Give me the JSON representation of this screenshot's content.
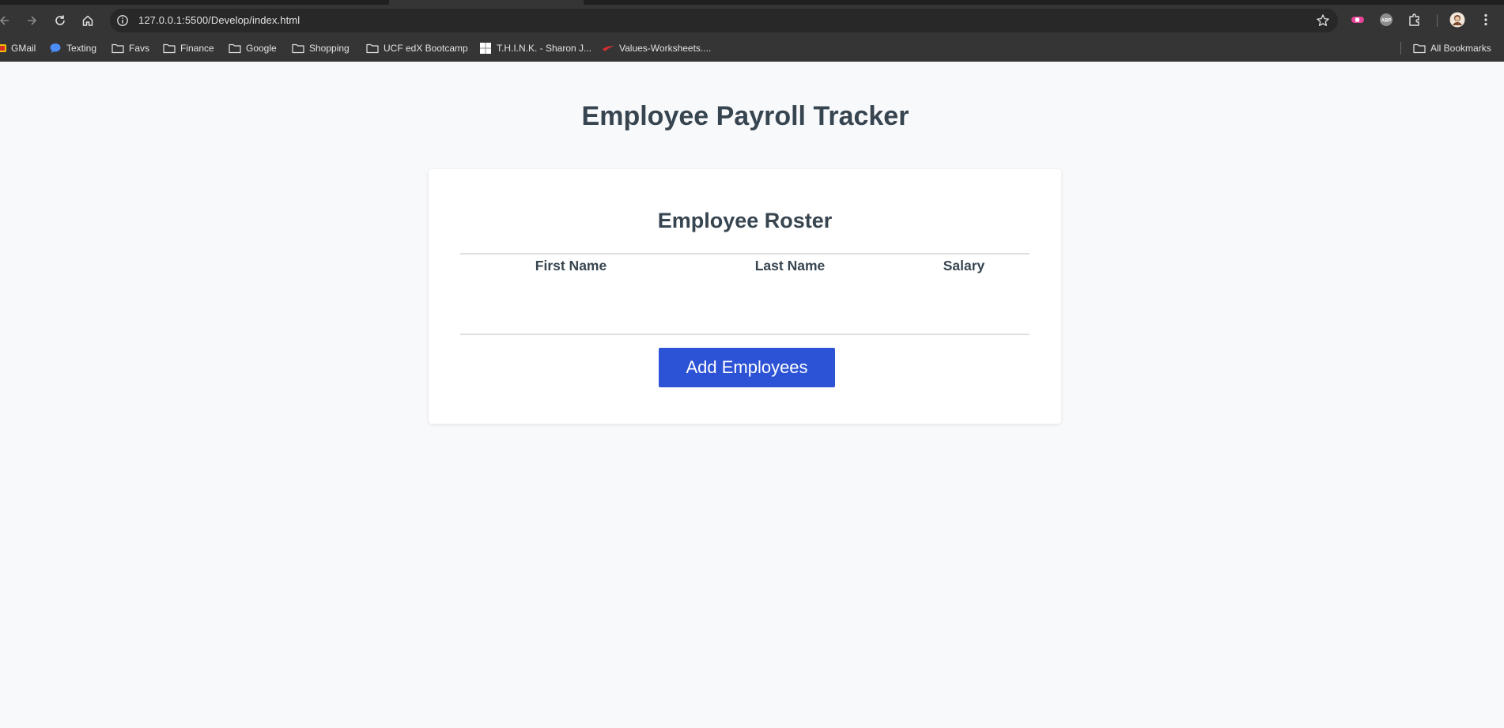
{
  "browser": {
    "url": "127.0.0.1:5500/Develop/index.html",
    "bookmarks": [
      {
        "label": "GMail",
        "icon": "gmail-icon"
      },
      {
        "label": "Texting",
        "icon": "messages-icon"
      },
      {
        "label": "Favs",
        "icon": "folder-icon"
      },
      {
        "label": "Finance",
        "icon": "folder-icon"
      },
      {
        "label": "Google",
        "icon": "folder-icon"
      },
      {
        "label": "Shopping",
        "icon": "folder-icon"
      },
      {
        "label": "UCF edX Bootcamp",
        "icon": "folder-icon"
      },
      {
        "label": "T.H.I.N.K. - Sharon J...",
        "icon": "page-icon"
      },
      {
        "label": "Values-Worksheets....",
        "icon": "page-icon"
      }
    ],
    "all_bookmarks": "All Bookmarks"
  },
  "page": {
    "title": "Employee Payroll Tracker",
    "roster": {
      "title": "Employee Roster",
      "columns": [
        "First Name",
        "Last Name",
        "Salary"
      ],
      "rows": []
    },
    "add_button": "Add Employees"
  },
  "colors": {
    "heading": "#374550",
    "button": "#2c52d6",
    "page_bg": "#f8f9fb",
    "chrome_bg": "#353535"
  }
}
